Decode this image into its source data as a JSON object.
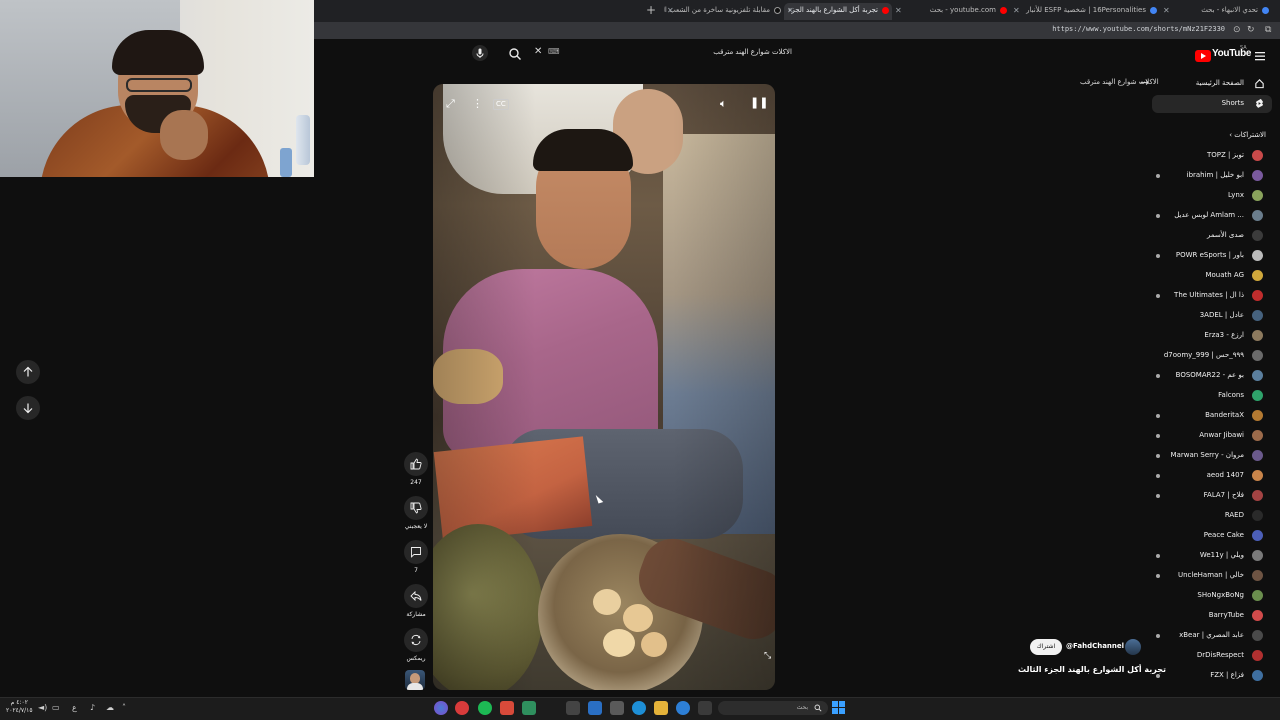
{
  "browser": {
    "tabs": [
      {
        "label": "تحدي الانبهاء - بحث",
        "active": false
      },
      {
        "label": "16Personalities | شخصية ESFP للأنبار",
        "active": false
      },
      {
        "label": "youtube.com - بحث",
        "active": false
      },
      {
        "label": "تجربة أكل الشوارع بالهند الجزء",
        "active": true
      },
      {
        "label": "مقابلة تلفزيونية ساخرة من الشعب ال",
        "active": false
      }
    ],
    "url": "https://www.youtube.com/shorts/mNz21F2330"
  },
  "header": {
    "logo_text": "YouTube",
    "logo_region": "SA",
    "search_query": "الاكلات شوارع الهند مترقب",
    "search_kbd": "⌨"
  },
  "query_back": "الاكلات شوارع الهند مترقب",
  "guide": {
    "home_label": "الصفحة الرئيسية",
    "shorts_label": "Shorts",
    "subscriptions_heading": "الاشتراكات",
    "subscriptions": [
      {
        "name": "TOPZ | توبز",
        "color": "#c84a4a",
        "dot": false
      },
      {
        "name": "ibrahim | ابو خليل",
        "color": "#7a5a9e",
        "dot": true
      },
      {
        "name": "Lynx",
        "color": "#8aa35c",
        "dot": false
      },
      {
        "name": "لوبس عديل Amlam ...",
        "color": "#6a7d8c",
        "dot": true
      },
      {
        "name": "صدى الأسمر",
        "color": "#3b3b3b",
        "dot": false
      },
      {
        "name": "POWR eSports | باور",
        "color": "#bbbbbb",
        "dot": true
      },
      {
        "name": "Mouath AG",
        "color": "#d0a83c",
        "dot": false
      },
      {
        "name": "The Ultimates | ذا ال",
        "color": "#c02d2d",
        "dot": true
      },
      {
        "name": "3ADEL | عادل",
        "color": "#46627e",
        "dot": false
      },
      {
        "name": "Erza3 - ارزع",
        "color": "#8d7a5e",
        "dot": false
      },
      {
        "name": "d7oomy_999 | ٩٩٩_حس",
        "color": "#6a6a6a",
        "dot": false
      },
      {
        "name": "BOSOMAR22 - بو عم",
        "color": "#5b7f9e",
        "dot": true
      },
      {
        "name": "Falcons",
        "color": "#2fa36b",
        "dot": false
      },
      {
        "name": "BanderitaX",
        "color": "#b47a32",
        "dot": true
      },
      {
        "name": "Anwar Jibawi",
        "color": "#9c6b4b",
        "dot": true
      },
      {
        "name": "Marwan Serry - مروان",
        "color": "#6b5a8c",
        "dot": true
      },
      {
        "name": "aeod 1407",
        "color": "#c8844a",
        "dot": true
      },
      {
        "name": "FALA7 | فلاح",
        "color": "#a34343",
        "dot": true
      },
      {
        "name": "RAED",
        "color": "#2a2a2a",
        "dot": false
      },
      {
        "name": "Peace Cake",
        "color": "#4c5fb8",
        "dot": false
      },
      {
        "name": "We11y | ويلي",
        "color": "#7a7a7a",
        "dot": true
      },
      {
        "name": "UncleHaman | خالي",
        "color": "#6e5443",
        "dot": true
      },
      {
        "name": "SHoNgxBoNg",
        "color": "#6b8e4e",
        "dot": false
      },
      {
        "name": "BarryTube",
        "color": "#d14b4b",
        "dot": false
      },
      {
        "name": "xBear | عابد المصري",
        "color": "#4a4a4a",
        "dot": true
      },
      {
        "name": "DrDisRespect",
        "color": "#b03030",
        "dot": false
      },
      {
        "name": "FZX | فزاع",
        "color": "#3f6fa0",
        "dot": true
      }
    ]
  },
  "actions": {
    "likes": "247",
    "dislike_label": "لا يعجبني",
    "comments": "7",
    "share_label": "مشاركة",
    "remix_label": "ريمكس"
  },
  "video": {
    "channel": "@FahdChannel",
    "subscribe_label": "اشتراك",
    "title": "تجربة أكل الشوارع بالهند الجزء الثالث"
  },
  "taskbar": {
    "time": "٤:٠٢ م",
    "date": "٢٠٢٤/٧/١٥",
    "lang": "ع",
    "search_placeholder": "بحث"
  },
  "colors": {
    "background": "#0f0f0f",
    "youtube_red": "#ff0000",
    "selected_row": "#272727"
  }
}
